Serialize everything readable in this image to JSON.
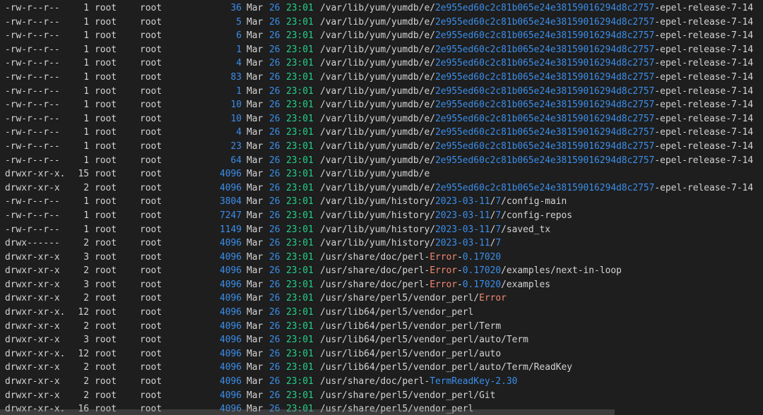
{
  "colors": {
    "background": "#1e1e1e",
    "text": "#d4d4d4",
    "blue": "#3b8eea",
    "green": "#23d18b",
    "orange": "#f48771"
  },
  "rows": [
    {
      "perm": "-rw-r--r--",
      "links": "1",
      "owner": "root",
      "group": "root",
      "size": "36",
      "month": "Mar",
      "day": "26",
      "time": "23:01",
      "path": [
        {
          "t": "/var/lib/yum/yumdb/e/",
          "c": "default"
        },
        {
          "t": "2e955ed60c2c81b065e24e38159016294d8c2757",
          "c": "blue"
        },
        {
          "t": "-epel-release-7-14",
          "c": "default"
        }
      ]
    },
    {
      "perm": "-rw-r--r--",
      "links": "1",
      "owner": "root",
      "group": "root",
      "size": "5",
      "month": "Mar",
      "day": "26",
      "time": "23:01",
      "path": [
        {
          "t": "/var/lib/yum/yumdb/e/",
          "c": "default"
        },
        {
          "t": "2e955ed60c2c81b065e24e38159016294d8c2757",
          "c": "blue"
        },
        {
          "t": "-epel-release-7-14",
          "c": "default"
        }
      ]
    },
    {
      "perm": "-rw-r--r--",
      "links": "1",
      "owner": "root",
      "group": "root",
      "size": "6",
      "month": "Mar",
      "day": "26",
      "time": "23:01",
      "path": [
        {
          "t": "/var/lib/yum/yumdb/e/",
          "c": "default"
        },
        {
          "t": "2e955ed60c2c81b065e24e38159016294d8c2757",
          "c": "blue"
        },
        {
          "t": "-epel-release-7-14",
          "c": "default"
        }
      ]
    },
    {
      "perm": "-rw-r--r--",
      "links": "1",
      "owner": "root",
      "group": "root",
      "size": "1",
      "month": "Mar",
      "day": "26",
      "time": "23:01",
      "path": [
        {
          "t": "/var/lib/yum/yumdb/e/",
          "c": "default"
        },
        {
          "t": "2e955ed60c2c81b065e24e38159016294d8c2757",
          "c": "blue"
        },
        {
          "t": "-epel-release-7-14",
          "c": "default"
        }
      ]
    },
    {
      "perm": "-rw-r--r--",
      "links": "1",
      "owner": "root",
      "group": "root",
      "size": "4",
      "month": "Mar",
      "day": "26",
      "time": "23:01",
      "path": [
        {
          "t": "/var/lib/yum/yumdb/e/",
          "c": "default"
        },
        {
          "t": "2e955ed60c2c81b065e24e38159016294d8c2757",
          "c": "blue"
        },
        {
          "t": "-epel-release-7-14",
          "c": "default"
        }
      ]
    },
    {
      "perm": "-rw-r--r--",
      "links": "1",
      "owner": "root",
      "group": "root",
      "size": "83",
      "month": "Mar",
      "day": "26",
      "time": "23:01",
      "path": [
        {
          "t": "/var/lib/yum/yumdb/e/",
          "c": "default"
        },
        {
          "t": "2e955ed60c2c81b065e24e38159016294d8c2757",
          "c": "blue"
        },
        {
          "t": "-epel-release-7-14",
          "c": "default"
        }
      ]
    },
    {
      "perm": "-rw-r--r--",
      "links": "1",
      "owner": "root",
      "group": "root",
      "size": "1",
      "month": "Mar",
      "day": "26",
      "time": "23:01",
      "path": [
        {
          "t": "/var/lib/yum/yumdb/e/",
          "c": "default"
        },
        {
          "t": "2e955ed60c2c81b065e24e38159016294d8c2757",
          "c": "blue"
        },
        {
          "t": "-epel-release-7-14",
          "c": "default"
        }
      ]
    },
    {
      "perm": "-rw-r--r--",
      "links": "1",
      "owner": "root",
      "group": "root",
      "size": "10",
      "month": "Mar",
      "day": "26",
      "time": "23:01",
      "path": [
        {
          "t": "/var/lib/yum/yumdb/e/",
          "c": "default"
        },
        {
          "t": "2e955ed60c2c81b065e24e38159016294d8c2757",
          "c": "blue"
        },
        {
          "t": "-epel-release-7-14",
          "c": "default"
        }
      ]
    },
    {
      "perm": "-rw-r--r--",
      "links": "1",
      "owner": "root",
      "group": "root",
      "size": "10",
      "month": "Mar",
      "day": "26",
      "time": "23:01",
      "path": [
        {
          "t": "/var/lib/yum/yumdb/e/",
          "c": "default"
        },
        {
          "t": "2e955ed60c2c81b065e24e38159016294d8c2757",
          "c": "blue"
        },
        {
          "t": "-epel-release-7-14",
          "c": "default"
        }
      ]
    },
    {
      "perm": "-rw-r--r--",
      "links": "1",
      "owner": "root",
      "group": "root",
      "size": "4",
      "month": "Mar",
      "day": "26",
      "time": "23:01",
      "path": [
        {
          "t": "/var/lib/yum/yumdb/e/",
          "c": "default"
        },
        {
          "t": "2e955ed60c2c81b065e24e38159016294d8c2757",
          "c": "blue"
        },
        {
          "t": "-epel-release-7-14",
          "c": "default"
        }
      ]
    },
    {
      "perm": "-rw-r--r--",
      "links": "1",
      "owner": "root",
      "group": "root",
      "size": "23",
      "month": "Mar",
      "day": "26",
      "time": "23:01",
      "path": [
        {
          "t": "/var/lib/yum/yumdb/e/",
          "c": "default"
        },
        {
          "t": "2e955ed60c2c81b065e24e38159016294d8c2757",
          "c": "blue"
        },
        {
          "t": "-epel-release-7-14",
          "c": "default"
        }
      ]
    },
    {
      "perm": "-rw-r--r--",
      "links": "1",
      "owner": "root",
      "group": "root",
      "size": "64",
      "month": "Mar",
      "day": "26",
      "time": "23:01",
      "path": [
        {
          "t": "/var/lib/yum/yumdb/e/",
          "c": "default"
        },
        {
          "t": "2e955ed60c2c81b065e24e38159016294d8c2757",
          "c": "blue"
        },
        {
          "t": "-epel-release-7-14",
          "c": "default"
        }
      ]
    },
    {
      "perm": "drwxr-xr-x.",
      "links": "15",
      "owner": "root",
      "group": "root",
      "size": "4096",
      "month": "Mar",
      "day": "26",
      "time": "23:01",
      "path": [
        {
          "t": "/var/lib/yum/yumdb/e",
          "c": "default"
        }
      ]
    },
    {
      "perm": "drwxr-xr-x",
      "links": "2",
      "owner": "root",
      "group": "root",
      "size": "4096",
      "month": "Mar",
      "day": "26",
      "time": "23:01",
      "path": [
        {
          "t": "/var/lib/yum/yumdb/e/",
          "c": "default"
        },
        {
          "t": "2e955ed60c2c81b065e24e38159016294d8c2757",
          "c": "blue"
        },
        {
          "t": "-epel-release-7-14",
          "c": "default"
        }
      ]
    },
    {
      "perm": "-rw-r--r--",
      "links": "1",
      "owner": "root",
      "group": "root",
      "size": "3804",
      "month": "Mar",
      "day": "26",
      "time": "23:01",
      "path": [
        {
          "t": "/var/lib/yum/history/",
          "c": "default"
        },
        {
          "t": "2023-03-11",
          "c": "blue"
        },
        {
          "t": "/",
          "c": "default"
        },
        {
          "t": "7",
          "c": "blue"
        },
        {
          "t": "/config-main",
          "c": "default"
        }
      ]
    },
    {
      "perm": "-rw-r--r--",
      "links": "1",
      "owner": "root",
      "group": "root",
      "size": "7247",
      "month": "Mar",
      "day": "26",
      "time": "23:01",
      "path": [
        {
          "t": "/var/lib/yum/history/",
          "c": "default"
        },
        {
          "t": "2023-03-11",
          "c": "blue"
        },
        {
          "t": "/",
          "c": "default"
        },
        {
          "t": "7",
          "c": "blue"
        },
        {
          "t": "/config-repos",
          "c": "default"
        }
      ]
    },
    {
      "perm": "-rw-r--r--",
      "links": "1",
      "owner": "root",
      "group": "root",
      "size": "1149",
      "month": "Mar",
      "day": "26",
      "time": "23:01",
      "path": [
        {
          "t": "/var/lib/yum/history/",
          "c": "default"
        },
        {
          "t": "2023-03-11",
          "c": "blue"
        },
        {
          "t": "/",
          "c": "default"
        },
        {
          "t": "7",
          "c": "blue"
        },
        {
          "t": "/saved_tx",
          "c": "default"
        }
      ]
    },
    {
      "perm": "drwx------",
      "links": "2",
      "owner": "root",
      "group": "root",
      "size": "4096",
      "month": "Mar",
      "day": "26",
      "time": "23:01",
      "path": [
        {
          "t": "/var/lib/yum/history/",
          "c": "default"
        },
        {
          "t": "2023-03-11",
          "c": "blue"
        },
        {
          "t": "/",
          "c": "default"
        },
        {
          "t": "7",
          "c": "blue"
        }
      ]
    },
    {
      "perm": "drwxr-xr-x",
      "links": "3",
      "owner": "root",
      "group": "root",
      "size": "4096",
      "month": "Mar",
      "day": "26",
      "time": "23:01",
      "path": [
        {
          "t": "/usr/share/doc/perl-",
          "c": "default"
        },
        {
          "t": "Error",
          "c": "orange"
        },
        {
          "t": "-",
          "c": "default"
        },
        {
          "t": "0.17020",
          "c": "blue"
        }
      ]
    },
    {
      "perm": "drwxr-xr-x",
      "links": "2",
      "owner": "root",
      "group": "root",
      "size": "4096",
      "month": "Mar",
      "day": "26",
      "time": "23:01",
      "path": [
        {
          "t": "/usr/share/doc/perl-",
          "c": "default"
        },
        {
          "t": "Error",
          "c": "orange"
        },
        {
          "t": "-",
          "c": "default"
        },
        {
          "t": "0.17020",
          "c": "blue"
        },
        {
          "t": "/examples/next-in-loop",
          "c": "default"
        }
      ]
    },
    {
      "perm": "drwxr-xr-x",
      "links": "3",
      "owner": "root",
      "group": "root",
      "size": "4096",
      "month": "Mar",
      "day": "26",
      "time": "23:01",
      "path": [
        {
          "t": "/usr/share/doc/perl-",
          "c": "default"
        },
        {
          "t": "Error",
          "c": "orange"
        },
        {
          "t": "-",
          "c": "default"
        },
        {
          "t": "0.17020",
          "c": "blue"
        },
        {
          "t": "/examples",
          "c": "default"
        }
      ]
    },
    {
      "perm": "drwxr-xr-x",
      "links": "2",
      "owner": "root",
      "group": "root",
      "size": "4096",
      "month": "Mar",
      "day": "26",
      "time": "23:01",
      "path": [
        {
          "t": "/usr/share/perl5/vendor_perl/",
          "c": "default"
        },
        {
          "t": "Error",
          "c": "orange"
        }
      ]
    },
    {
      "perm": "drwxr-xr-x.",
      "links": "12",
      "owner": "root",
      "group": "root",
      "size": "4096",
      "month": "Mar",
      "day": "26",
      "time": "23:01",
      "path": [
        {
          "t": "/usr/lib64/perl5/vendor_perl",
          "c": "default"
        }
      ]
    },
    {
      "perm": "drwxr-xr-x",
      "links": "2",
      "owner": "root",
      "group": "root",
      "size": "4096",
      "month": "Mar",
      "day": "26",
      "time": "23:01",
      "path": [
        {
          "t": "/usr/lib64/perl5/vendor_perl/Term",
          "c": "default"
        }
      ]
    },
    {
      "perm": "drwxr-xr-x",
      "links": "3",
      "owner": "root",
      "group": "root",
      "size": "4096",
      "month": "Mar",
      "day": "26",
      "time": "23:01",
      "path": [
        {
          "t": "/usr/lib64/perl5/vendor_perl/auto/Term",
          "c": "default"
        }
      ]
    },
    {
      "perm": "drwxr-xr-x.",
      "links": "12",
      "owner": "root",
      "group": "root",
      "size": "4096",
      "month": "Mar",
      "day": "26",
      "time": "23:01",
      "path": [
        {
          "t": "/usr/lib64/perl5/vendor_perl/auto",
          "c": "default"
        }
      ]
    },
    {
      "perm": "drwxr-xr-x",
      "links": "2",
      "owner": "root",
      "group": "root",
      "size": "4096",
      "month": "Mar",
      "day": "26",
      "time": "23:01",
      "path": [
        {
          "t": "/usr/lib64/perl5/vendor_perl/auto/Term/ReadKey",
          "c": "default"
        }
      ]
    },
    {
      "perm": "drwxr-xr-x",
      "links": "2",
      "owner": "root",
      "group": "root",
      "size": "4096",
      "month": "Mar",
      "day": "26",
      "time": "23:01",
      "path": [
        {
          "t": "/usr/share/doc/perl-",
          "c": "default"
        },
        {
          "t": "TermReadKey-2.30",
          "c": "blue"
        }
      ]
    },
    {
      "perm": "drwxr-xr-x",
      "links": "2",
      "owner": "root",
      "group": "root",
      "size": "4096",
      "month": "Mar",
      "day": "26",
      "time": "23:01",
      "path": [
        {
          "t": "/usr/share/perl5/vendor_perl/Git",
          "c": "default"
        }
      ]
    },
    {
      "perm": "drwxr-xr-x.",
      "links": "16",
      "owner": "root",
      "group": "root",
      "size": "4096",
      "month": "Mar",
      "day": "26",
      "time": "23:01",
      "path": [
        {
          "t": "/usr/share/perl5/vendor_perl",
          "c": "default"
        }
      ]
    }
  ]
}
